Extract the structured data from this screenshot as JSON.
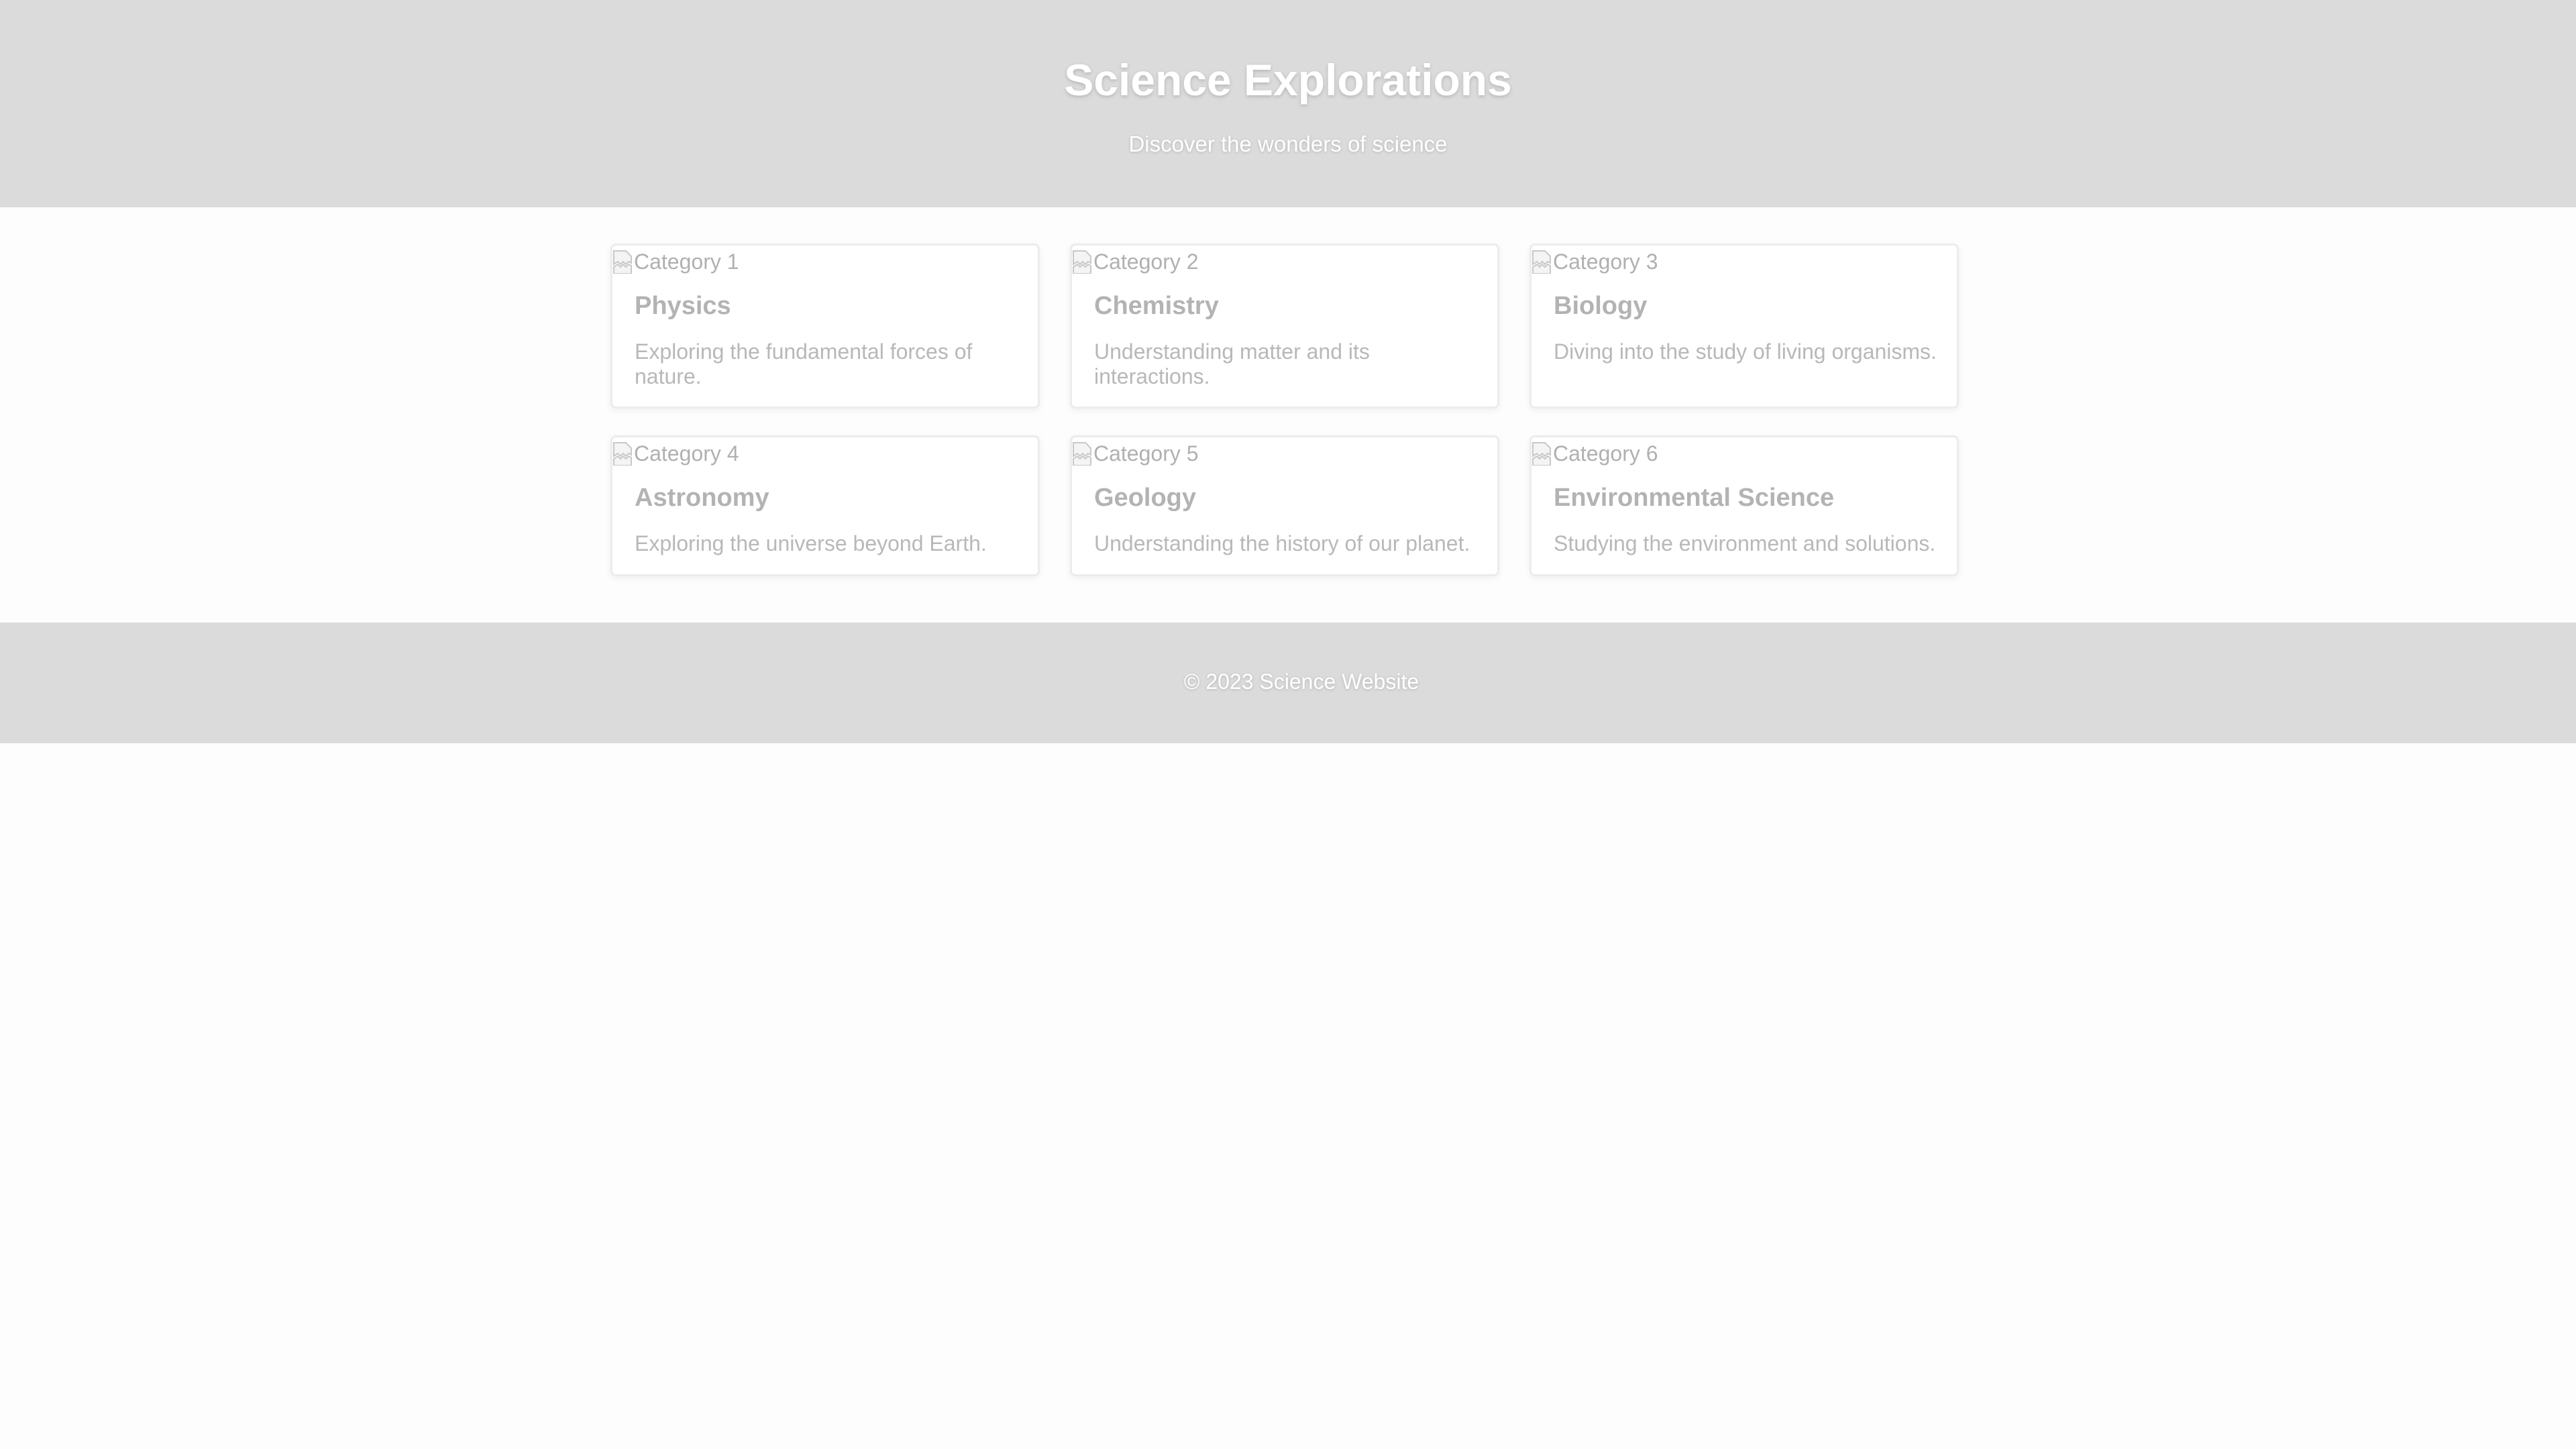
{
  "header": {
    "title": "Science Explorations",
    "tagline": "Discover the wonders of science"
  },
  "cards": [
    {
      "image_alt": "Category 1",
      "title": "Physics",
      "description": "Exploring the fundamental forces of nature."
    },
    {
      "image_alt": "Category 2",
      "title": "Chemistry",
      "description": "Understanding matter and its interactions."
    },
    {
      "image_alt": "Category 3",
      "title": "Biology",
      "description": "Diving into the study of living organisms."
    },
    {
      "image_alt": "Category 4",
      "title": "Astronomy",
      "description": "Exploring the universe beyond Earth."
    },
    {
      "image_alt": "Category 5",
      "title": "Geology",
      "description": "Understanding the history of our planet."
    },
    {
      "image_alt": "Category 6",
      "title": "Environmental Science",
      "description": "Studying the environment and solutions."
    }
  ],
  "footer": {
    "copyright": "© 2023 Science Website"
  },
  "colors": {
    "header_bg": "#dbdbdb",
    "footer_bg": "#dbdbdb",
    "page_bg": "#fdfdfd",
    "card_border": "#ececec"
  },
  "icons": {
    "card_image": "broken-image-icon"
  }
}
